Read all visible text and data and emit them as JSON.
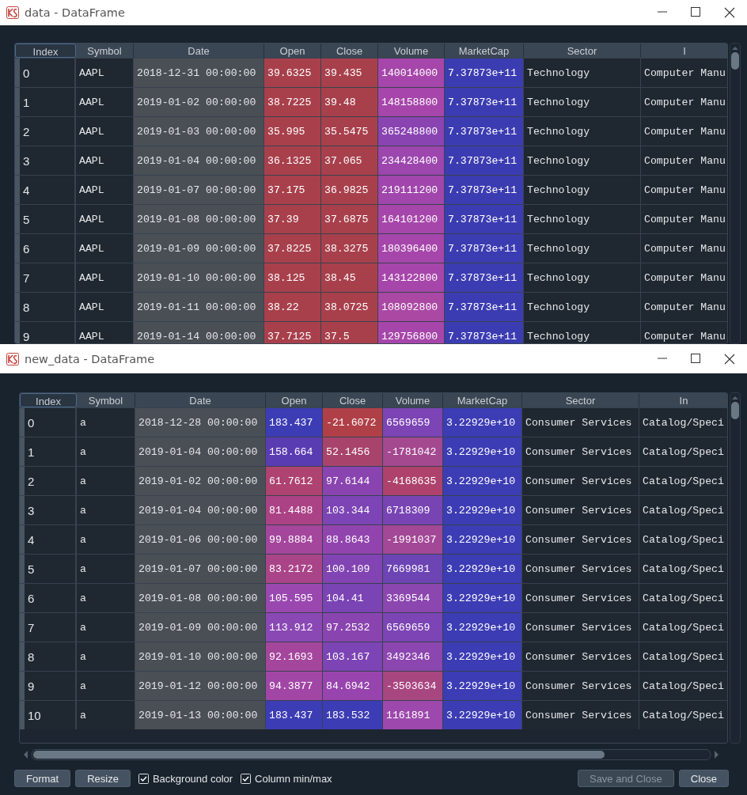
{
  "windows": [
    {
      "title": "data - DataFrame",
      "table": {
        "index_header": "Index",
        "columns": [
          "Symbol",
          "Date",
          "Open",
          "Close",
          "Volume",
          "MarketCap",
          "Sector",
          "I"
        ],
        "rows": [
          {
            "index": "0",
            "cells": [
              {
                "kind": "text",
                "text": "AAPL"
              },
              {
                "kind": "date",
                "text": "2018-12-31 00:00:00"
              },
              {
                "kind": "heat",
                "text": "39.6325",
                "color": "#a8404c"
              },
              {
                "kind": "heat",
                "text": "39.435",
                "color": "#a8404c"
              },
              {
                "kind": "heat",
                "text": "140014000",
                "color": "#a646aa"
              },
              {
                "kind": "heat",
                "text": "7.37873e+11",
                "color": "#3c3cb2"
              },
              {
                "kind": "text",
                "text": "Technology"
              },
              {
                "kind": "text",
                "text": "Computer Manu"
              }
            ]
          },
          {
            "index": "1",
            "cells": [
              {
                "kind": "text",
                "text": "AAPL"
              },
              {
                "kind": "date",
                "text": "2019-01-02 00:00:00"
              },
              {
                "kind": "heat",
                "text": "38.7225",
                "color": "#a8404c"
              },
              {
                "kind": "heat",
                "text": "39.48",
                "color": "#a8404c"
              },
              {
                "kind": "heat",
                "text": "148158800",
                "color": "#a646aa"
              },
              {
                "kind": "heat",
                "text": "7.37873e+11",
                "color": "#3c3cb2"
              },
              {
                "kind": "text",
                "text": "Technology"
              },
              {
                "kind": "text",
                "text": "Computer Manu"
              }
            ]
          },
          {
            "index": "2",
            "cells": [
              {
                "kind": "text",
                "text": "AAPL"
              },
              {
                "kind": "date",
                "text": "2019-01-03 00:00:00"
              },
              {
                "kind": "heat",
                "text": "35.995",
                "color": "#a8404c"
              },
              {
                "kind": "heat",
                "text": "35.5475",
                "color": "#a8404c"
              },
              {
                "kind": "heat",
                "text": "365248800",
                "color": "#8a44b2"
              },
              {
                "kind": "heat",
                "text": "7.37873e+11",
                "color": "#3c3cb2"
              },
              {
                "kind": "text",
                "text": "Technology"
              },
              {
                "kind": "text",
                "text": "Computer Manu"
              }
            ]
          },
          {
            "index": "3",
            "cells": [
              {
                "kind": "text",
                "text": "AAPL"
              },
              {
                "kind": "date",
                "text": "2019-01-04 00:00:00"
              },
              {
                "kind": "heat",
                "text": "36.1325",
                "color": "#a8404c"
              },
              {
                "kind": "heat",
                "text": "37.065",
                "color": "#a8404c"
              },
              {
                "kind": "heat",
                "text": "234428400",
                "color": "#9c46ae"
              },
              {
                "kind": "heat",
                "text": "7.37873e+11",
                "color": "#3c3cb2"
              },
              {
                "kind": "text",
                "text": "Technology"
              },
              {
                "kind": "text",
                "text": "Computer Manu"
              }
            ]
          },
          {
            "index": "4",
            "cells": [
              {
                "kind": "text",
                "text": "AAPL"
              },
              {
                "kind": "date",
                "text": "2019-01-07 00:00:00"
              },
              {
                "kind": "heat",
                "text": "37.175",
                "color": "#a8404c"
              },
              {
                "kind": "heat",
                "text": "36.9825",
                "color": "#a8404c"
              },
              {
                "kind": "heat",
                "text": "219111200",
                "color": "#a046ac"
              },
              {
                "kind": "heat",
                "text": "7.37873e+11",
                "color": "#3c3cb2"
              },
              {
                "kind": "text",
                "text": "Technology"
              },
              {
                "kind": "text",
                "text": "Computer Manu"
              }
            ]
          },
          {
            "index": "5",
            "cells": [
              {
                "kind": "text",
                "text": "AAPL"
              },
              {
                "kind": "date",
                "text": "2019-01-08 00:00:00"
              },
              {
                "kind": "heat",
                "text": "37.39",
                "color": "#a8404c"
              },
              {
                "kind": "heat",
                "text": "37.6875",
                "color": "#a8404c"
              },
              {
                "kind": "heat",
                "text": "164101200",
                "color": "#a646aa"
              },
              {
                "kind": "heat",
                "text": "7.37873e+11",
                "color": "#3c3cb2"
              },
              {
                "kind": "text",
                "text": "Technology"
              },
              {
                "kind": "text",
                "text": "Computer Manu"
              }
            ]
          },
          {
            "index": "6",
            "cells": [
              {
                "kind": "text",
                "text": "AAPL"
              },
              {
                "kind": "date",
                "text": "2019-01-09 00:00:00"
              },
              {
                "kind": "heat",
                "text": "37.8225",
                "color": "#a8404c"
              },
              {
                "kind": "heat",
                "text": "38.3275",
                "color": "#a8404c"
              },
              {
                "kind": "heat",
                "text": "180396400",
                "color": "#a646aa"
              },
              {
                "kind": "heat",
                "text": "7.37873e+11",
                "color": "#3c3cb2"
              },
              {
                "kind": "text",
                "text": "Technology"
              },
              {
                "kind": "text",
                "text": "Computer Manu"
              }
            ]
          },
          {
            "index": "7",
            "cells": [
              {
                "kind": "text",
                "text": "AAPL"
              },
              {
                "kind": "date",
                "text": "2019-01-10 00:00:00"
              },
              {
                "kind": "heat",
                "text": "38.125",
                "color": "#a8404c"
              },
              {
                "kind": "heat",
                "text": "38.45",
                "color": "#a8404c"
              },
              {
                "kind": "heat",
                "text": "143122800",
                "color": "#a646aa"
              },
              {
                "kind": "heat",
                "text": "7.37873e+11",
                "color": "#3c3cb2"
              },
              {
                "kind": "text",
                "text": "Technology"
              },
              {
                "kind": "text",
                "text": "Computer Manu"
              }
            ]
          },
          {
            "index": "8",
            "cells": [
              {
                "kind": "text",
                "text": "AAPL"
              },
              {
                "kind": "date",
                "text": "2019-01-11 00:00:00"
              },
              {
                "kind": "heat",
                "text": "38.22",
                "color": "#a8404c"
              },
              {
                "kind": "heat",
                "text": "38.0725",
                "color": "#a8404c"
              },
              {
                "kind": "heat",
                "text": "108092800",
                "color": "#aa48a4"
              },
              {
                "kind": "heat",
                "text": "7.37873e+11",
                "color": "#3c3cb2"
              },
              {
                "kind": "text",
                "text": "Technology"
              },
              {
                "kind": "text",
                "text": "Computer Manu"
              }
            ]
          },
          {
            "index": "9",
            "cells": [
              {
                "kind": "text",
                "text": "AAPL"
              },
              {
                "kind": "date",
                "text": "2019-01-14 00:00:00"
              },
              {
                "kind": "heat",
                "text": "37.7125",
                "color": "#a8404c"
              },
              {
                "kind": "heat",
                "text": "37.5",
                "color": "#a8404c"
              },
              {
                "kind": "heat",
                "text": "129756800",
                "color": "#a646aa"
              },
              {
                "kind": "heat",
                "text": "7.37873e+11",
                "color": "#3c3cb2"
              },
              {
                "kind": "text",
                "text": "Technology"
              },
              {
                "kind": "text",
                "text": "Computer Manu"
              }
            ]
          }
        ]
      }
    },
    {
      "title": "new_data - DataFrame",
      "table": {
        "index_header": "Index",
        "columns": [
          "Symbol",
          "Date",
          "Open",
          "Close",
          "Volume",
          "MarketCap",
          "Sector",
          "In"
        ],
        "rows": [
          {
            "index": "0",
            "cells": [
              {
                "kind": "text",
                "text": "a"
              },
              {
                "kind": "date",
                "text": "2018-12-28 00:00:00"
              },
              {
                "kind": "heat",
                "text": "183.437",
                "color": "#3c3cb4"
              },
              {
                "kind": "heat",
                "text": "-21.6072",
                "color": "#b04048"
              },
              {
                "kind": "heat",
                "text": "6569659",
                "color": "#7c44b4"
              },
              {
                "kind": "heat",
                "text": "3.22929e+10",
                "color": "#3c3cb4"
              },
              {
                "kind": "text",
                "text": "Consumer Services"
              },
              {
                "kind": "text",
                "text": "Catalog/Speci"
              }
            ]
          },
          {
            "index": "1",
            "cells": [
              {
                "kind": "text",
                "text": "a"
              },
              {
                "kind": "date",
                "text": "2019-01-04 00:00:00"
              },
              {
                "kind": "heat",
                "text": "158.664",
                "color": "#5a3cb2"
              },
              {
                "kind": "heat",
                "text": "52.1456",
                "color": "#a8446c"
              },
              {
                "kind": "heat",
                "text": "-1781042",
                "color": "#a44890"
              },
              {
                "kind": "heat",
                "text": "3.22929e+10",
                "color": "#3c3cb4"
              },
              {
                "kind": "text",
                "text": "Consumer Services"
              },
              {
                "kind": "text",
                "text": "Catalog/Speci"
              }
            ]
          },
          {
            "index": "2",
            "cells": [
              {
                "kind": "text",
                "text": "a"
              },
              {
                "kind": "date",
                "text": "2019-01-02 00:00:00"
              },
              {
                "kind": "heat",
                "text": "61.7612",
                "color": "#ae4270"
              },
              {
                "kind": "heat",
                "text": "97.6144",
                "color": "#8a44b0"
              },
              {
                "kind": "heat",
                "text": "-4168635",
                "color": "#ae426c"
              },
              {
                "kind": "heat",
                "text": "3.22929e+10",
                "color": "#3c3cb4"
              },
              {
                "kind": "text",
                "text": "Consumer Services"
              },
              {
                "kind": "text",
                "text": "Catalog/Speci"
              }
            ]
          },
          {
            "index": "3",
            "cells": [
              {
                "kind": "text",
                "text": "a"
              },
              {
                "kind": "date",
                "text": "2019-01-04 00:00:00"
              },
              {
                "kind": "heat",
                "text": "81.4488",
                "color": "#ac4286"
              },
              {
                "kind": "heat",
                "text": "103.344",
                "color": "#7c44b4"
              },
              {
                "kind": "heat",
                "text": "6718309",
                "color": "#7844b4"
              },
              {
                "kind": "heat",
                "text": "3.22929e+10",
                "color": "#3c3cb4"
              },
              {
                "kind": "text",
                "text": "Consumer Services"
              },
              {
                "kind": "text",
                "text": "Catalog/Speci"
              }
            ]
          },
          {
            "index": "4",
            "cells": [
              {
                "kind": "text",
                "text": "a"
              },
              {
                "kind": "date",
                "text": "2019-01-06 00:00:00"
              },
              {
                "kind": "heat",
                "text": "99.8884",
                "color": "#a4469c"
              },
              {
                "kind": "heat",
                "text": "88.8643",
                "color": "#9244ae"
              },
              {
                "kind": "heat",
                "text": "-1991037",
                "color": "#a24896"
              },
              {
                "kind": "heat",
                "text": "3.22929e+10",
                "color": "#3c3cb4"
              },
              {
                "kind": "text",
                "text": "Consumer Services"
              },
              {
                "kind": "text",
                "text": "Catalog/Speci"
              }
            ]
          },
          {
            "index": "5",
            "cells": [
              {
                "kind": "text",
                "text": "a"
              },
              {
                "kind": "date",
                "text": "2019-01-07 00:00:00"
              },
              {
                "kind": "heat",
                "text": "83.2172",
                "color": "#aa4488"
              },
              {
                "kind": "heat",
                "text": "100.109",
                "color": "#8244b2"
              },
              {
                "kind": "heat",
                "text": "7669981",
                "color": "#6c44b4"
              },
              {
                "kind": "heat",
                "text": "3.22929e+10",
                "color": "#3c3cb4"
              },
              {
                "kind": "text",
                "text": "Consumer Services"
              },
              {
                "kind": "text",
                "text": "Catalog/Speci"
              }
            ]
          },
          {
            "index": "6",
            "cells": [
              {
                "kind": "text",
                "text": "a"
              },
              {
                "kind": "date",
                "text": "2019-01-08 00:00:00"
              },
              {
                "kind": "heat",
                "text": "105.595",
                "color": "#9a48b0"
              },
              {
                "kind": "heat",
                "text": "104.41",
                "color": "#7a44b4"
              },
              {
                "kind": "heat",
                "text": "3369544",
                "color": "#8c46b0"
              },
              {
                "kind": "heat",
                "text": "3.22929e+10",
                "color": "#3c3cb4"
              },
              {
                "kind": "text",
                "text": "Consumer Services"
              },
              {
                "kind": "text",
                "text": "Catalog/Speci"
              }
            ]
          },
          {
            "index": "7",
            "cells": [
              {
                "kind": "text",
                "text": "a"
              },
              {
                "kind": "date",
                "text": "2019-01-09 00:00:00"
              },
              {
                "kind": "heat",
                "text": "113.912",
                "color": "#8a48b4"
              },
              {
                "kind": "heat",
                "text": "97.2532",
                "color": "#8a44b0"
              },
              {
                "kind": "heat",
                "text": "6569659",
                "color": "#7c44b4"
              },
              {
                "kind": "heat",
                "text": "3.22929e+10",
                "color": "#3c3cb4"
              },
              {
                "kind": "text",
                "text": "Consumer Services"
              },
              {
                "kind": "text",
                "text": "Catalog/Speci"
              }
            ]
          },
          {
            "index": "8",
            "cells": [
              {
                "kind": "text",
                "text": "a"
              },
              {
                "kind": "date",
                "text": "2019-01-10 00:00:00"
              },
              {
                "kind": "heat",
                "text": "92.1693",
                "color": "#a4469c"
              },
              {
                "kind": "heat",
                "text": "103.167",
                "color": "#7c44b4"
              },
              {
                "kind": "heat",
                "text": "3492346",
                "color": "#8c46b0"
              },
              {
                "kind": "heat",
                "text": "3.22929e+10",
                "color": "#3c3cb4"
              },
              {
                "kind": "text",
                "text": "Consumer Services"
              },
              {
                "kind": "text",
                "text": "Catalog/Speci"
              }
            ]
          },
          {
            "index": "9",
            "cells": [
              {
                "kind": "text",
                "text": "a"
              },
              {
                "kind": "date",
                "text": "2019-01-12 00:00:00"
              },
              {
                "kind": "heat",
                "text": "94.3877",
                "color": "#a246a6"
              },
              {
                "kind": "heat",
                "text": "84.6942",
                "color": "#9844ae"
              },
              {
                "kind": "heat",
                "text": "-3503634",
                "color": "#a84680"
              },
              {
                "kind": "heat",
                "text": "3.22929e+10",
                "color": "#3c3cb4"
              },
              {
                "kind": "text",
                "text": "Consumer Services"
              },
              {
                "kind": "text",
                "text": "Catalog/Speci"
              }
            ]
          },
          {
            "index": "10",
            "cells": [
              {
                "kind": "text",
                "text": "a"
              },
              {
                "kind": "date",
                "text": "2019-01-13 00:00:00"
              },
              {
                "kind": "heat",
                "text": "183.437",
                "color": "#3c3cb4"
              },
              {
                "kind": "heat",
                "text": "183.532",
                "color": "#3c3cb4"
              },
              {
                "kind": "heat",
                "text": "1161891",
                "color": "#9c48ac"
              },
              {
                "kind": "heat",
                "text": "3.22929e+10",
                "color": "#3c3cb4"
              },
              {
                "kind": "text",
                "text": "Consumer Services"
              },
              {
                "kind": "text",
                "text": "Catalog/Speci"
              }
            ]
          }
        ]
      },
      "footer": {
        "left_buttons": [
          {
            "label": "Format",
            "disabled": false
          },
          {
            "label": "Resize",
            "disabled": false
          }
        ],
        "checkboxes": [
          {
            "label": "Background color",
            "checked": true
          },
          {
            "label": "Column min/max",
            "checked": true
          }
        ],
        "right_buttons": [
          {
            "label": "Save and Close",
            "disabled": true
          },
          {
            "label": "Close",
            "disabled": false
          }
        ]
      }
    }
  ]
}
